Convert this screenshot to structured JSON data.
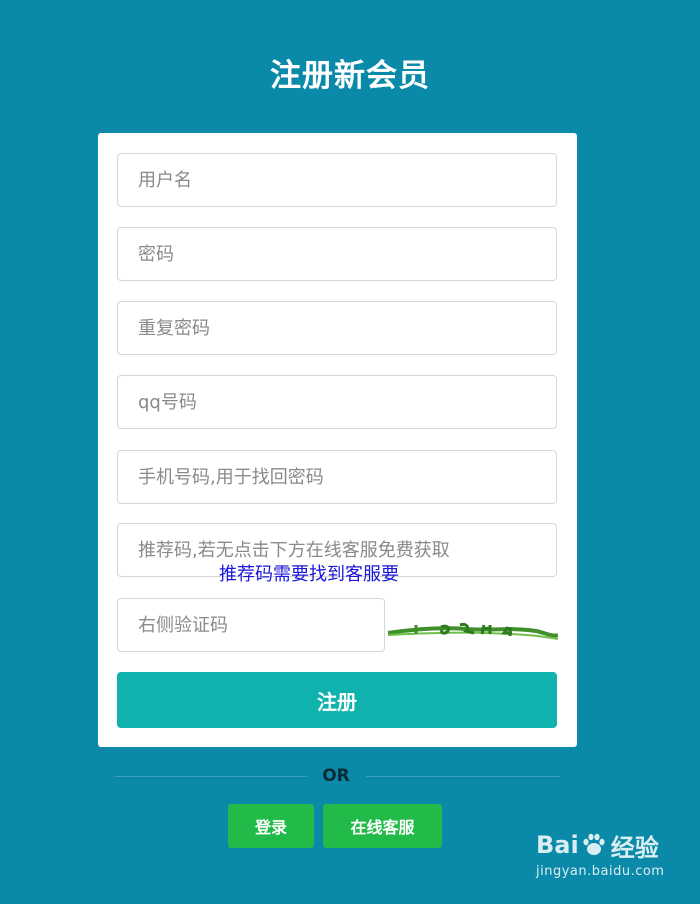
{
  "page": {
    "title": "注册新会员"
  },
  "form": {
    "username_placeholder": "用户名",
    "password_placeholder": "密码",
    "repeat_password_placeholder": "重复密码",
    "qq_placeholder": "qq号码",
    "phone_placeholder": "手机号码,用于找回密码",
    "referral_placeholder": "推荐码,若无点击下方在线客服免费获取",
    "referral_hint": "推荐码需要找到客服要",
    "captcha_placeholder": "右侧验证码",
    "submit_label": "注册"
  },
  "footer": {
    "or_label": "OR",
    "login_label": "登录",
    "support_label": "在线客服"
  },
  "watermark": {
    "brand_left": "Bai",
    "brand_right": "经验",
    "url": "jingyan.baidu.com"
  },
  "colors": {
    "background": "#0a8aa8",
    "submit": "#0fb2ac",
    "secondary_buttons": "#22bb4a",
    "hint_text": "#1a16d9",
    "captcha_green": "#3f8f2b"
  }
}
